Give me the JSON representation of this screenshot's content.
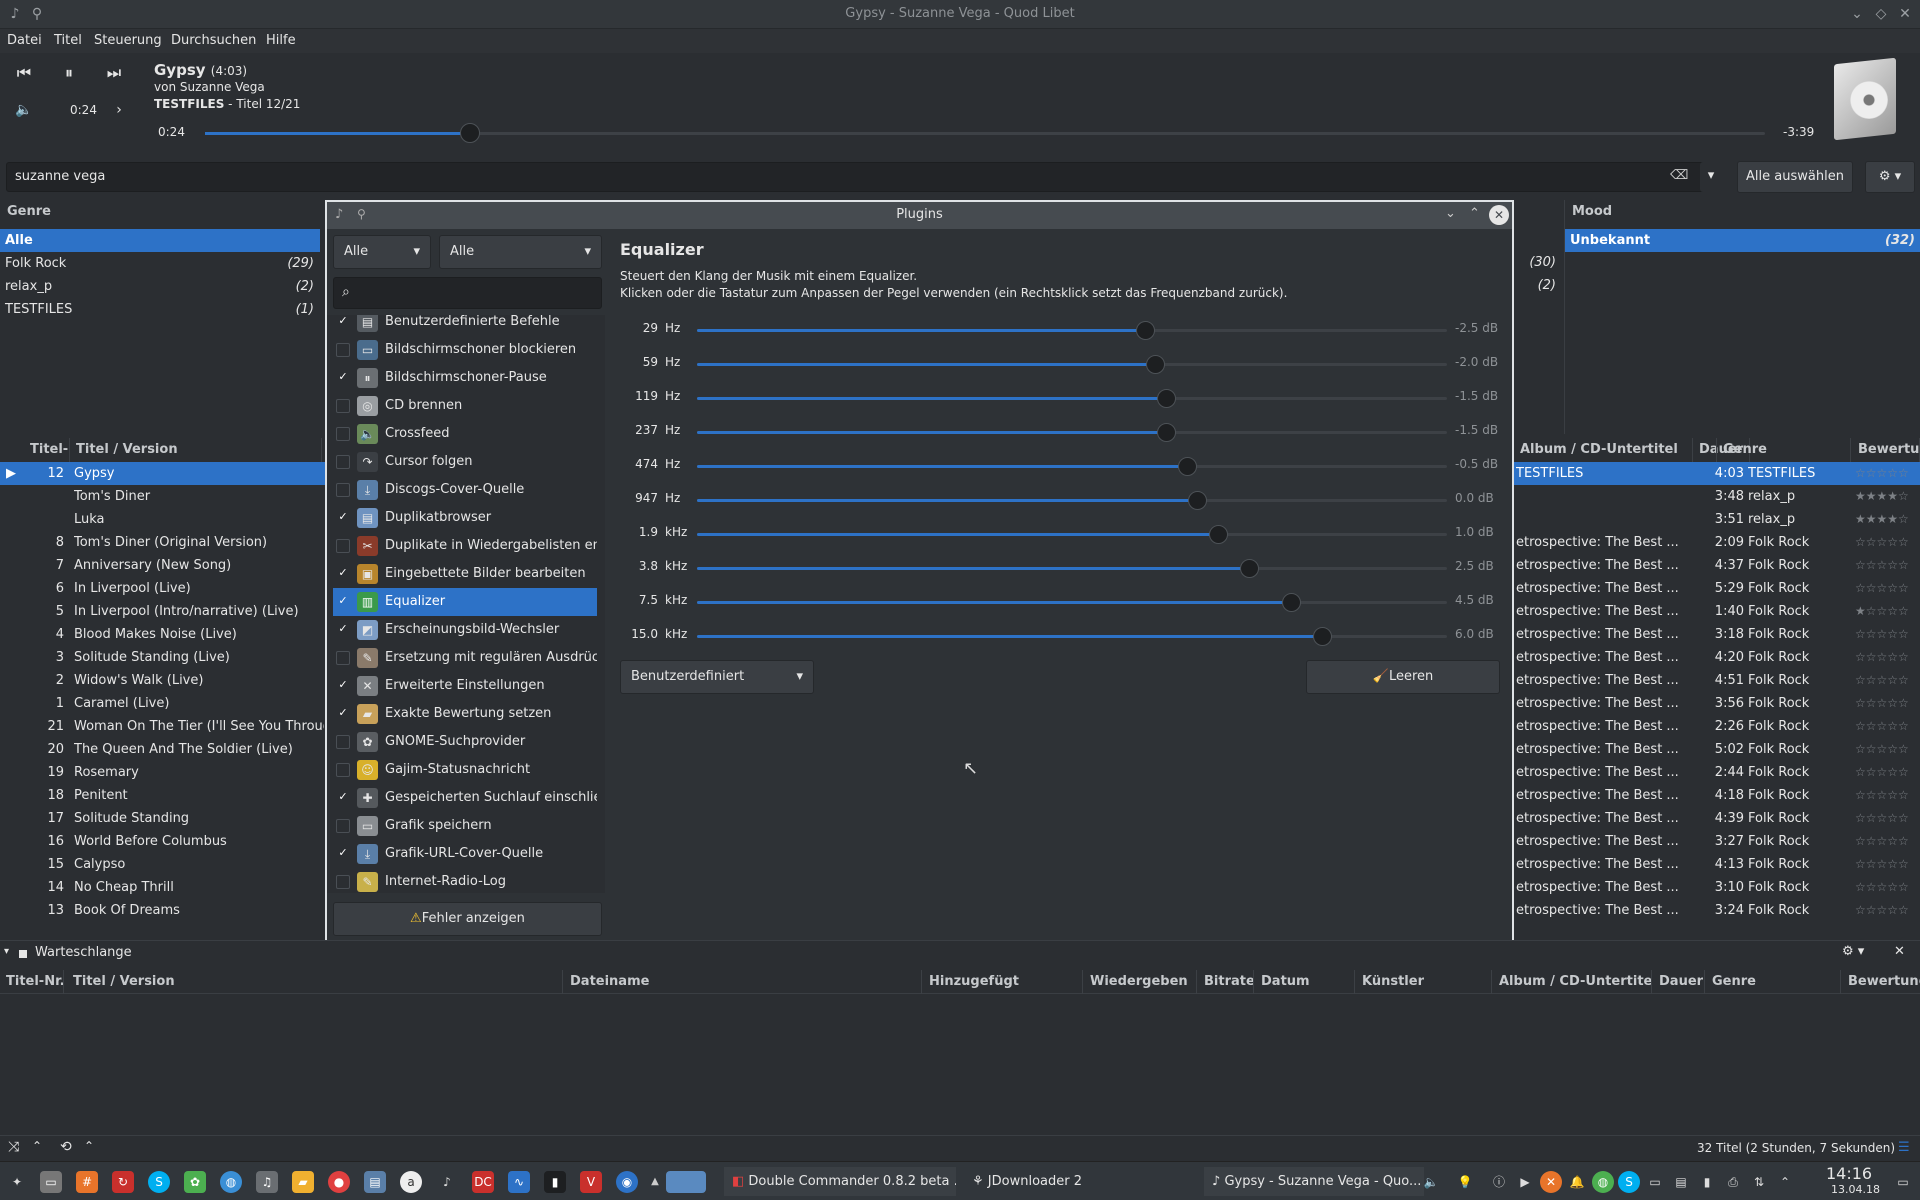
{
  "window_title": "Gypsy - Suzanne Vega - Quod Libet",
  "menu": [
    "Datei",
    "Titel",
    "Steuerung",
    "Durchsuchen",
    "Hilfe"
  ],
  "player": {
    "title": "Gypsy",
    "duration": "(4:03)",
    "artist_line": "von Suzanne Vega",
    "album_name": "TESTFILES",
    "album_track": " - Titel 12/21",
    "time_small": "0:24",
    "elapsed": "0:24",
    "remaining": "-3:39",
    "progress": 0.17
  },
  "search": {
    "value": "suzanne vega",
    "select_all": "Alle auswählen"
  },
  "genre_pane": {
    "header": "Genre",
    "items": [
      {
        "label": "Alle",
        "count": ""
      },
      {
        "label": "Folk Rock",
        "count": "(29)"
      },
      {
        "label": "relax_p",
        "count": "(2)"
      },
      {
        "label": "TESTFILES",
        "count": "(1)"
      }
    ]
  },
  "mid_pane_counts": [
    "(30)",
    "(2)"
  ],
  "mood_pane": {
    "header": "Mood",
    "items": [
      {
        "label": "Unbekannt",
        "count": "(32)"
      }
    ]
  },
  "song_columns": {
    "track": "Titel-",
    "title": "Titel / Version",
    "album": "Album / CD-Untertitel",
    "duration": "Dauer",
    "genre": "Genre",
    "rating": "Bewertun"
  },
  "songs": [
    {
      "track": "12",
      "title": "Gypsy",
      "album": "TESTFILES",
      "duration": "4:03",
      "genre": "TESTFILES",
      "rating": "☆☆☆☆☆",
      "playing": true
    },
    {
      "track": "",
      "title": "Tom's Diner",
      "album": "",
      "duration": "3:48",
      "genre": "relax_p",
      "rating": "★★★★☆"
    },
    {
      "track": "",
      "title": "Luka",
      "album": "",
      "duration": "3:51",
      "genre": "relax_p",
      "rating": "★★★★☆"
    },
    {
      "track": "8",
      "title": "Tom's Diner (Original Version)",
      "album": "etrospective: The Best ...",
      "duration": "2:09",
      "genre": "Folk Rock",
      "rating": "☆☆☆☆☆"
    },
    {
      "track": "7",
      "title": "Anniversary (New Song)",
      "album": "etrospective: The Best ...",
      "duration": "4:37",
      "genre": "Folk Rock",
      "rating": "☆☆☆☆☆"
    },
    {
      "track": "6",
      "title": "In Liverpool (Live)",
      "album": "etrospective: The Best ...",
      "duration": "5:29",
      "genre": "Folk Rock",
      "rating": "☆☆☆☆☆"
    },
    {
      "track": "5",
      "title": "In Liverpool (Intro/narrative) (Live)",
      "album": "etrospective: The Best ...",
      "duration": "1:40",
      "genre": "Folk Rock",
      "rating": "★☆☆☆☆"
    },
    {
      "track": "4",
      "title": "Blood Makes Noise (Live)",
      "album": "etrospective: The Best ...",
      "duration": "3:18",
      "genre": "Folk Rock",
      "rating": "☆☆☆☆☆"
    },
    {
      "track": "3",
      "title": "Solitude Standing (Live)",
      "album": "etrospective: The Best ...",
      "duration": "4:20",
      "genre": "Folk Rock",
      "rating": "☆☆☆☆☆"
    },
    {
      "track": "2",
      "title": "Widow's Walk (Live)",
      "album": "etrospective: The Best ...",
      "duration": "4:51",
      "genre": "Folk Rock",
      "rating": "☆☆☆☆☆"
    },
    {
      "track": "1",
      "title": "Caramel (Live)",
      "album": "etrospective: The Best ...",
      "duration": "3:56",
      "genre": "Folk Rock",
      "rating": "☆☆☆☆☆"
    },
    {
      "track": "21",
      "title": "Woman On The Tier (I'll See You Through)",
      "album": "etrospective: The Best ...",
      "duration": "2:26",
      "genre": "Folk Rock",
      "rating": "☆☆☆☆☆"
    },
    {
      "track": "20",
      "title": "The Queen And The Soldier (Live)",
      "album": "etrospective: The Best ...",
      "duration": "5:02",
      "genre": "Folk Rock",
      "rating": "☆☆☆☆☆"
    },
    {
      "track": "19",
      "title": "Rosemary",
      "album": "etrospective: The Best ...",
      "duration": "2:44",
      "genre": "Folk Rock",
      "rating": "☆☆☆☆☆"
    },
    {
      "track": "18",
      "title": "Penitent",
      "album": "etrospective: The Best ...",
      "duration": "4:18",
      "genre": "Folk Rock",
      "rating": "☆☆☆☆☆"
    },
    {
      "track": "17",
      "title": "Solitude Standing",
      "album": "etrospective: The Best ...",
      "duration": "4:39",
      "genre": "Folk Rock",
      "rating": "☆☆☆☆☆"
    },
    {
      "track": "16",
      "title": "World Before Columbus",
      "album": "etrospective: The Best ...",
      "duration": "3:27",
      "genre": "Folk Rock",
      "rating": "☆☆☆☆☆"
    },
    {
      "track": "15",
      "title": "Calypso",
      "album": "etrospective: The Best ...",
      "duration": "4:13",
      "genre": "Folk Rock",
      "rating": "☆☆☆☆☆"
    },
    {
      "track": "14",
      "title": "No Cheap Thrill",
      "album": "etrospective: The Best ...",
      "duration": "3:10",
      "genre": "Folk Rock",
      "rating": "☆☆☆☆☆"
    },
    {
      "track": "13",
      "title": "Book Of Dreams",
      "album": "etrospective: The Best ...",
      "duration": "3:24",
      "genre": "Folk Rock",
      "rating": "☆☆☆☆☆"
    }
  ],
  "plugins_dialog": {
    "title": "Plugins",
    "filter1": "Alle",
    "filter2": "Alle",
    "search_placeholder": "",
    "items": [
      {
        "label": "Benutzerdefinierte Befehle",
        "checked": true,
        "icon": "terminal-icon",
        "color": "#555b61"
      },
      {
        "label": "Bildschirmschoner blockieren",
        "checked": false,
        "icon": "monitor-icon",
        "color": "#4a6c8c"
      },
      {
        "label": "Bildschirmschoner-Pause",
        "checked": true,
        "icon": "pause-icon",
        "color": "#6b6f73"
      },
      {
        "label": "CD brennen",
        "checked": false,
        "icon": "disc-icon",
        "color": "#9a9ea2"
      },
      {
        "label": "Crossfeed",
        "checked": false,
        "icon": "speaker-icon",
        "color": "#6a8a5a"
      },
      {
        "label": "Cursor folgen",
        "checked": false,
        "icon": "cursor-icon",
        "color": "#3b3f44"
      },
      {
        "label": "Discogs-Cover-Quelle",
        "checked": false,
        "icon": "download-icon",
        "color": "#5a7fa8"
      },
      {
        "label": "Duplikatbrowser",
        "checked": true,
        "icon": "document-icon",
        "color": "#6f93c0"
      },
      {
        "label": "Duplikate in Wiedergabelisten entf...",
        "checked": false,
        "icon": "broom-icon",
        "color": "#8a3b2a"
      },
      {
        "label": "Eingebettete Bilder bearbeiten",
        "checked": true,
        "icon": "image-icon",
        "color": "#b8852c"
      },
      {
        "label": "Equalizer",
        "checked": true,
        "icon": "equalizer-icon",
        "color": "#3b9a4a",
        "selected": true
      },
      {
        "label": "Erscheinungsbild-Wechsler",
        "checked": true,
        "icon": "appearance-icon",
        "color": "#7c9cc4"
      },
      {
        "label": "Ersetzung mit regulären Ausdrücken",
        "checked": false,
        "icon": "edit-icon",
        "color": "#8a7a6a"
      },
      {
        "label": "Erweiterte Einstellungen",
        "checked": true,
        "icon": "tools-icon",
        "color": "#7a7e82"
      },
      {
        "label": "Exakte Bewertung setzen",
        "checked": true,
        "icon": "folder-icon",
        "color": "#c8a15a"
      },
      {
        "label": "GNOME-Suchprovider",
        "checked": false,
        "icon": "gnome-icon",
        "color": "#5a5e62"
      },
      {
        "label": "Gajim-Statusnachricht",
        "checked": false,
        "icon": "smiley-icon",
        "color": "#d8b02a"
      },
      {
        "label": "Gespeicherten Suchlauf einschließ...",
        "checked": true,
        "icon": "gamepad-icon",
        "color": "#55595d"
      },
      {
        "label": "Grafik speichern",
        "checked": false,
        "icon": "save-icon",
        "color": "#8a8e92"
      },
      {
        "label": "Grafik-URL-Cover-Quelle",
        "checked": true,
        "icon": "download-icon",
        "color": "#5a7fa8"
      },
      {
        "label": "Internet-Radio-Log",
        "checked": false,
        "icon": "pencil-icon",
        "color": "#c8b04a"
      }
    ],
    "errors_button": "Fehler anzeigen",
    "detail_title": "Equalizer",
    "detail_desc1": "Steuert den Klang der Musik mit einem Equalizer.",
    "detail_desc2": "Klicken oder die Tastatur zum Anpassen der Pegel verwenden (ein Rechtsklick setzt das Frequenzband zurück).",
    "bands": [
      {
        "freq": "29",
        "unit": "Hz",
        "db": "-2.5 dB",
        "value": -2.5
      },
      {
        "freq": "59",
        "unit": "Hz",
        "db": "-2.0 dB",
        "value": -2.0
      },
      {
        "freq": "119",
        "unit": "Hz",
        "db": "-1.5 dB",
        "value": -1.5
      },
      {
        "freq": "237",
        "unit": "Hz",
        "db": "-1.5 dB",
        "value": -1.5
      },
      {
        "freq": "474",
        "unit": "Hz",
        "db": "-0.5 dB",
        "value": -0.5
      },
      {
        "freq": "947",
        "unit": "Hz",
        "db": "0.0 dB",
        "value": 0.0
      },
      {
        "freq": "1.9",
        "unit": "kHz",
        "db": "1.0 dB",
        "value": 1.0
      },
      {
        "freq": "3.8",
        "unit": "kHz",
        "db": "2.5 dB",
        "value": 2.5
      },
      {
        "freq": "7.5",
        "unit": "kHz",
        "db": "4.5 dB",
        "value": 4.5
      },
      {
        "freq": "15.0",
        "unit": "kHz",
        "db": "6.0 dB",
        "value": 6.0
      }
    ],
    "preset": "Benutzerdefiniert",
    "clear_button": "Leeren"
  },
  "queue": {
    "title": "Warteschlange",
    "columns": [
      "Titel-Nr.",
      "Titel / Version",
      "Dateiname",
      "Hinzugefügt",
      "Wiedergeben",
      "Bitrate",
      "Datum",
      "Künstler",
      "Album / CD-Untertitel",
      "Dauer",
      "Genre",
      "Bewertung"
    ]
  },
  "status": "32 Titel (2 Stunden, 7 Sekunden)",
  "taskbar": {
    "tasks": [
      "Double Commander 0.8.2 beta ...",
      "JDownloader 2",
      "Gypsy - Suzanne Vega - Quo..."
    ],
    "time": "14:16",
    "date": "13.04.18"
  }
}
